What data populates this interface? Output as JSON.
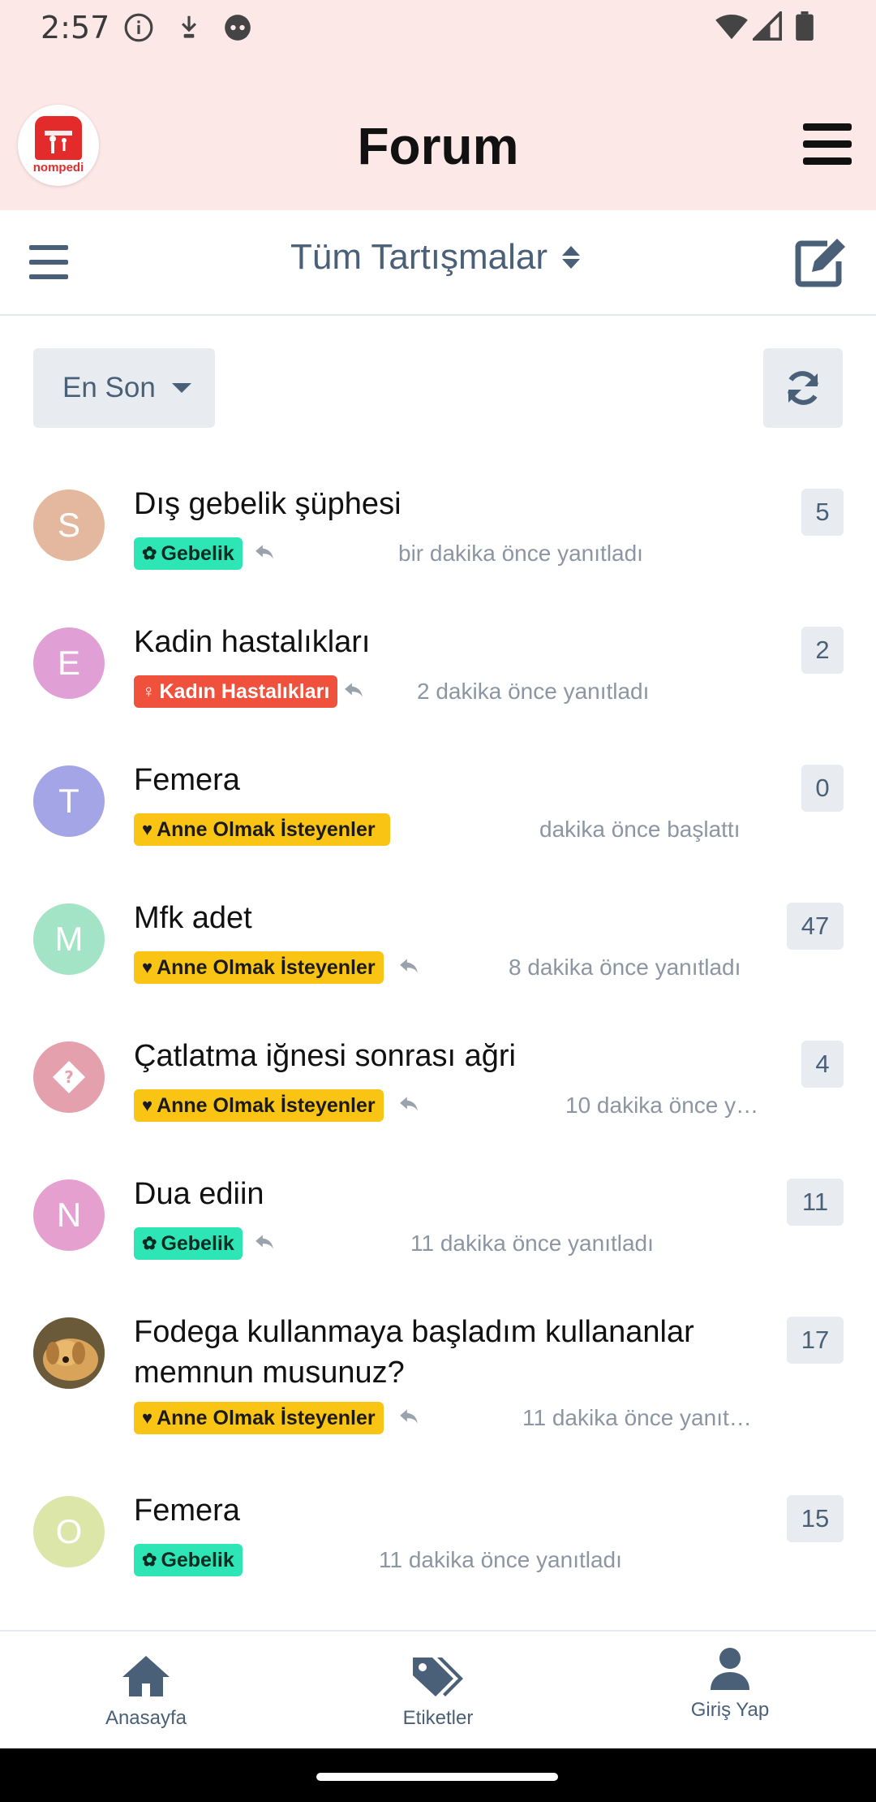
{
  "status_bar": {
    "time": "2:57"
  },
  "header": {
    "title": "Forum",
    "logo_text": "nompedi"
  },
  "subheader": {
    "scope_label": "Tüm Tartışmalar"
  },
  "controls": {
    "sort_label": "En Son"
  },
  "colors": {
    "header_bg": "#fde8e8",
    "accent": "#4a6078",
    "tag_gebelik": "#2ee6b5",
    "tag_kadin": "#f0513c",
    "tag_anne": "#f9c413"
  },
  "discussions": [
    {
      "avatar_letter": "S",
      "avatar_color": "#e3b89e",
      "title": "Dış gebelik şüphesi",
      "tag": "Gebelik",
      "tag_icon": "baby-icon",
      "time": "bir dakika önce yanıtladı",
      "count": "5"
    },
    {
      "avatar_letter": "E",
      "avatar_color": "#e0a0d6",
      "title": "Kadin hastalıkları",
      "tag": "Kadın Hastalıkları",
      "tag_icon": "venus-icon",
      "time": "2 dakika önce yanıtladı",
      "count": "2"
    },
    {
      "avatar_letter": "T",
      "avatar_color": "#a3a5e6",
      "title": "Femera",
      "tag": "Anne Olmak İsteyenler",
      "tag_icon": "heart-icon",
      "time": "dakika önce başlattı",
      "count": "0"
    },
    {
      "avatar_letter": "M",
      "avatar_color": "#a3e3c6",
      "title": "Mfk adet",
      "tag": "Anne Olmak İsteyenler",
      "tag_icon": "heart-icon",
      "time": "8 dakika önce yanıtladı",
      "count": "47"
    },
    {
      "avatar_letter": "?",
      "avatar_color": "#e5a0ad",
      "title": "Çatlatma iğnesi sonrası ağri",
      "tag": "Anne Olmak İsteyenler",
      "tag_icon": "heart-icon",
      "time": "10 dakika önce y…",
      "count": "4"
    },
    {
      "avatar_letter": "N",
      "avatar_color": "#e6a0cf",
      "title": "Dua ediin",
      "tag": "Gebelik",
      "tag_icon": "baby-icon",
      "time": "11 dakika önce yanıtladı",
      "count": "11"
    },
    {
      "avatar_letter": "",
      "avatar_color": "#9a7a4a",
      "title": "Fodega kullanmaya başladım kullananlar memnun musunuz?",
      "tag": "Anne Olmak İsteyenler",
      "tag_icon": "heart-icon",
      "time": "11 dakika önce yanıt…",
      "count": "17"
    },
    {
      "avatar_letter": "O",
      "avatar_color": "#dbe6a8",
      "title": "Femera",
      "tag": "Gebelik",
      "tag_icon": "baby-icon",
      "time": "11 dakika önce yanıtladı",
      "count": "15"
    }
  ],
  "bottom_nav": [
    {
      "label": "Anasayfa",
      "icon": "home-icon"
    },
    {
      "label": "Etiketler",
      "icon": "tags-icon"
    },
    {
      "label": "Giriş Yap",
      "icon": "user-icon"
    }
  ]
}
